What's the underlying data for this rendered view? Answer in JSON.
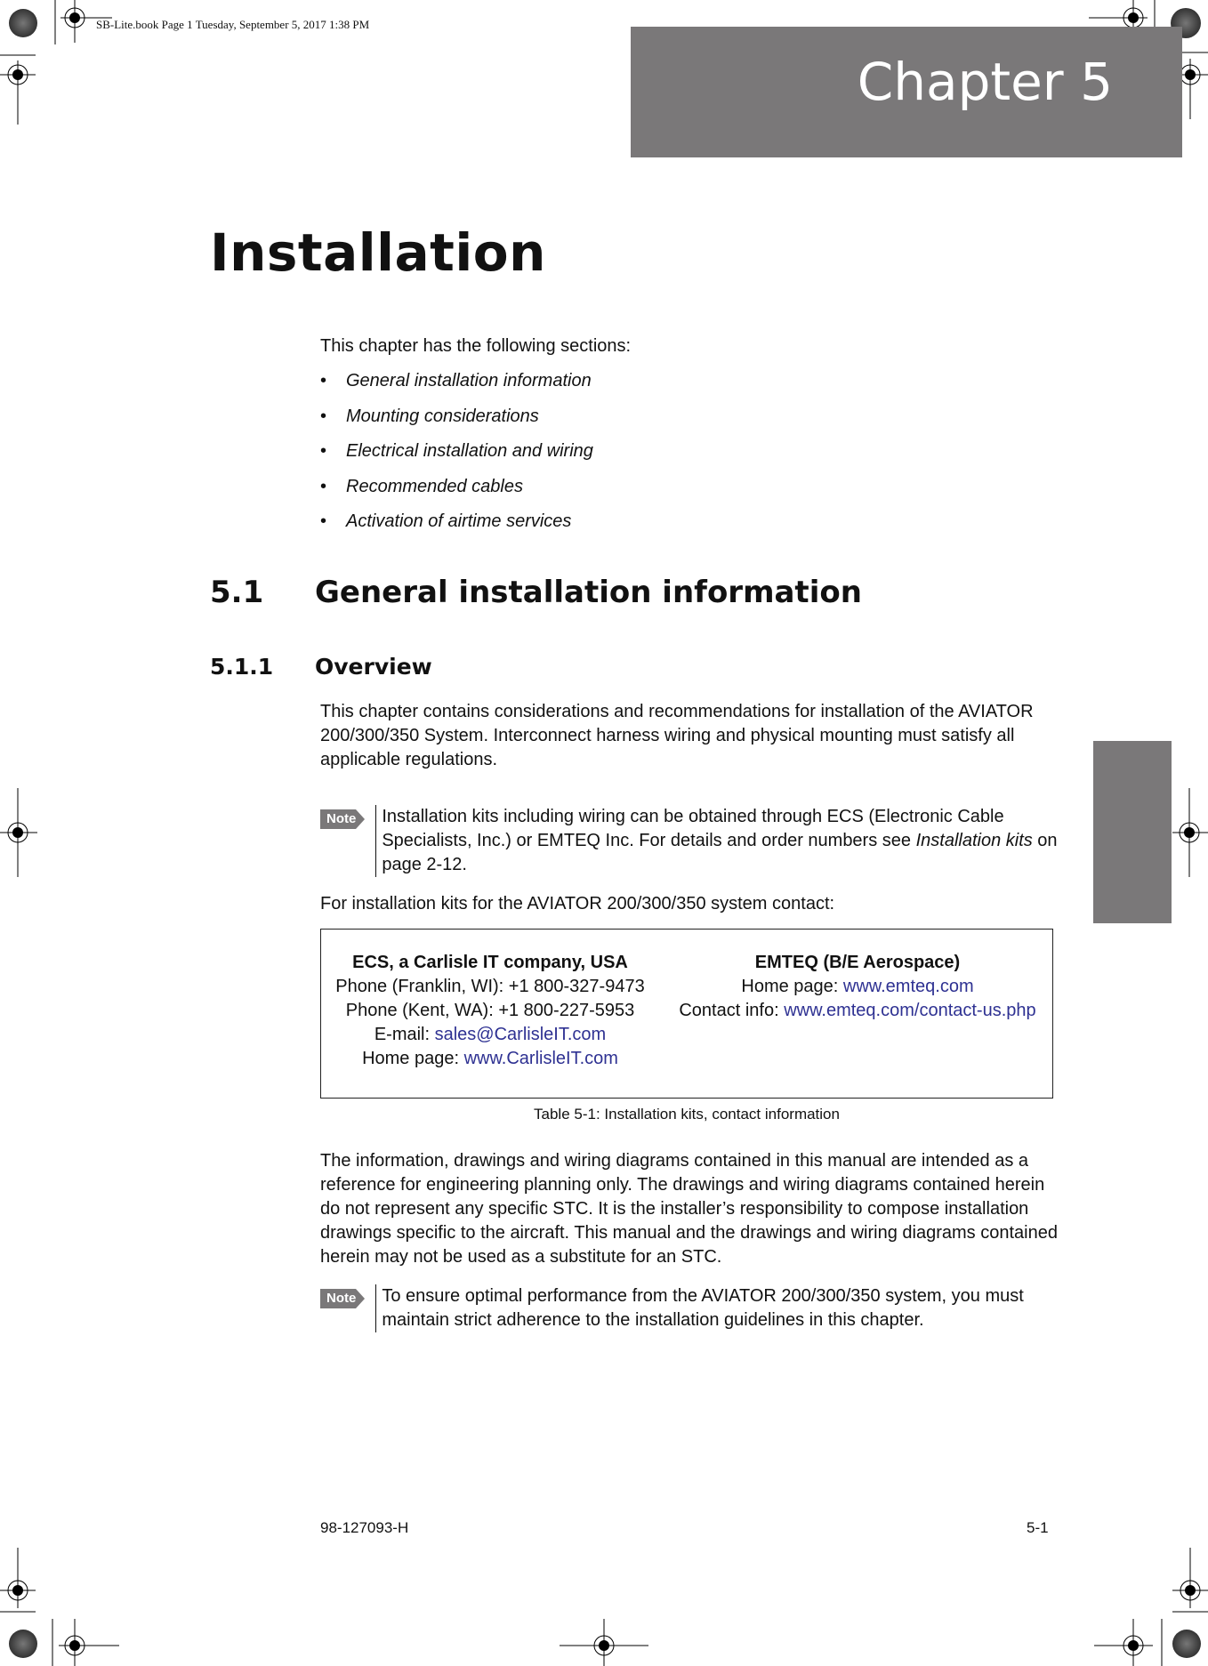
{
  "slug": "SB-Lite.book  Page 1  Tuesday, September 5, 2017  1:38 PM",
  "chapter_label": "Chapter 5",
  "title": "Installation",
  "intro": "This chapter has the following sections:",
  "sections": [
    "General installation information",
    "Mounting considerations",
    "Electrical installation and wiring",
    "Recommended cables",
    "Activation of airtime services"
  ],
  "heading1": {
    "number": "5.1",
    "text": "General installation information"
  },
  "heading2": {
    "number": "5.1.1",
    "text": "Overview"
  },
  "para1": "This chapter contains considerations and recommendations for installation of the AVIATOR 200/300/350 System. Interconnect harness wiring and physical mounting must satisfy all applicable regulations.",
  "note_label": "Note",
  "note1": {
    "text_before": "Installation kits including wiring can be obtained through ECS (Electronic Cable Specialists, Inc.) or EMTEQ Inc. For details and order numbers see ",
    "ref": "Installation kits",
    "text_after": " on page 2-12."
  },
  "para2": "For installation kits for the AVIATOR 200/300/350 system contact:",
  "contacts": {
    "ecs": {
      "name": "ECS, a Carlisle IT company, USA",
      "phone1_label": "Phone (Franklin, WI): ",
      "phone1": "+1 800-327-9473",
      "phone2_label": "Phone (Kent, WA): ",
      "phone2": "+1 800-227-5953",
      "email_label": "E-mail: ",
      "email": "sales@CarlisleIT.com",
      "home_label": "Home page: ",
      "home": "www.CarlisleIT.com"
    },
    "emteq": {
      "name": "EMTEQ (B/E Aerospace)",
      "home_label": "Home page: ",
      "home": "www.emteq.com",
      "contact_label": "Contact info: ",
      "contact": "www.emteq.com/contact-us.php"
    }
  },
  "caption": "Table 5-1: Installation kits, contact information",
  "para3": "The information, drawings and wiring diagrams contained in this manual are intended as a reference for engineering planning only. The drawings and wiring diagrams contained herein do not represent any specific STC. It is the installer’s responsibility to compose installation drawings specific to the aircraft. This manual and the drawings and wiring diagrams contained herein may not be used as a substitute for an STC.",
  "note2": "To ensure optimal performance from the AVIATOR 200/300/350 system, you must maintain strict adherence to the installation guidelines in this chapter.",
  "footer": {
    "doc_number": "98-127093-H",
    "page": "5-1"
  },
  "colors": {
    "accent_gray": "#7a7879",
    "link": "#2e3192"
  }
}
